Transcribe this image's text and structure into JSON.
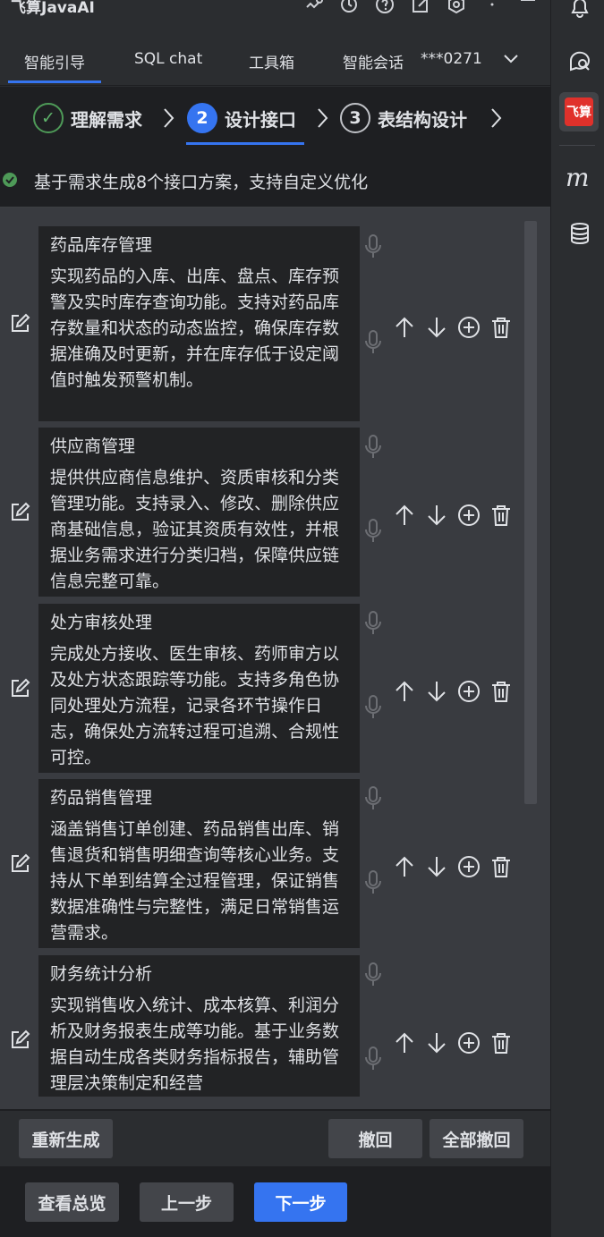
{
  "app": {
    "title": "飞算JavaAI"
  },
  "tabs": [
    {
      "label": "智能引导",
      "active": true
    },
    {
      "label": "SQL chat",
      "active": false
    },
    {
      "label": "工具箱",
      "active": false
    },
    {
      "label": "智能会话",
      "active": false
    }
  ],
  "account": "***0271",
  "steps": [
    {
      "num": "✓",
      "label": "理解需求",
      "state": "done"
    },
    {
      "num": "2",
      "label": "设计接口",
      "state": "active"
    },
    {
      "num": "3",
      "label": "表结构设计",
      "state": "todo"
    }
  ],
  "info": {
    "text": "基于需求生成8个接口方案，支持自定义优化"
  },
  "cards": [
    {
      "title": "药品库存管理",
      "desc": "实现药品的入库、出库、盘点、库存预警及实时库存查询功能。支持对药品库存数量和状态的动态监控，确保库存数据准确及时更新，并在库存低于设定阈值时触发预警机制。"
    },
    {
      "title": "供应商管理",
      "desc": "提供供应商信息维护、资质审核和分类管理功能。支持录入、修改、删除供应商基础信息，验证其资质有效性，并根据业务需求进行分类归档，保障供应链信息完整可靠。"
    },
    {
      "title": "处方审核处理",
      "desc": "完成处方接收、医生审核、药师审方以及处方状态跟踪等功能。支持多角色协同处理处方流程，记录各环节操作日志，确保处方流转过程可追溯、合规性可控。"
    },
    {
      "title": "药品销售管理",
      "desc": "涵盖销售订单创建、药品销售出库、销售退货和销售明细查询等核心业务。支持从下单到结算全过程管理，保证销售数据准确性与完整性，满足日常销售运营需求。"
    },
    {
      "title": "财务统计分析",
      "desc": "实现销售收入统计、成本核算、利润分析及财务报表生成等功能。基于业务数据自动生成各类财务指标报告，辅助管理层决策制定和经营"
    }
  ],
  "actionbar": {
    "regenerate": "重新生成",
    "undo": "撤回",
    "undo_all": "全部撤回"
  },
  "footer": {
    "overview": "查看总览",
    "prev": "上一步",
    "next": "下一步"
  },
  "rightbar": {
    "logo_text": "飞算",
    "m_icon": "m"
  },
  "colors": {
    "accent": "#3574f0",
    "success": "#4e9a58",
    "brand": "#e0312b"
  }
}
